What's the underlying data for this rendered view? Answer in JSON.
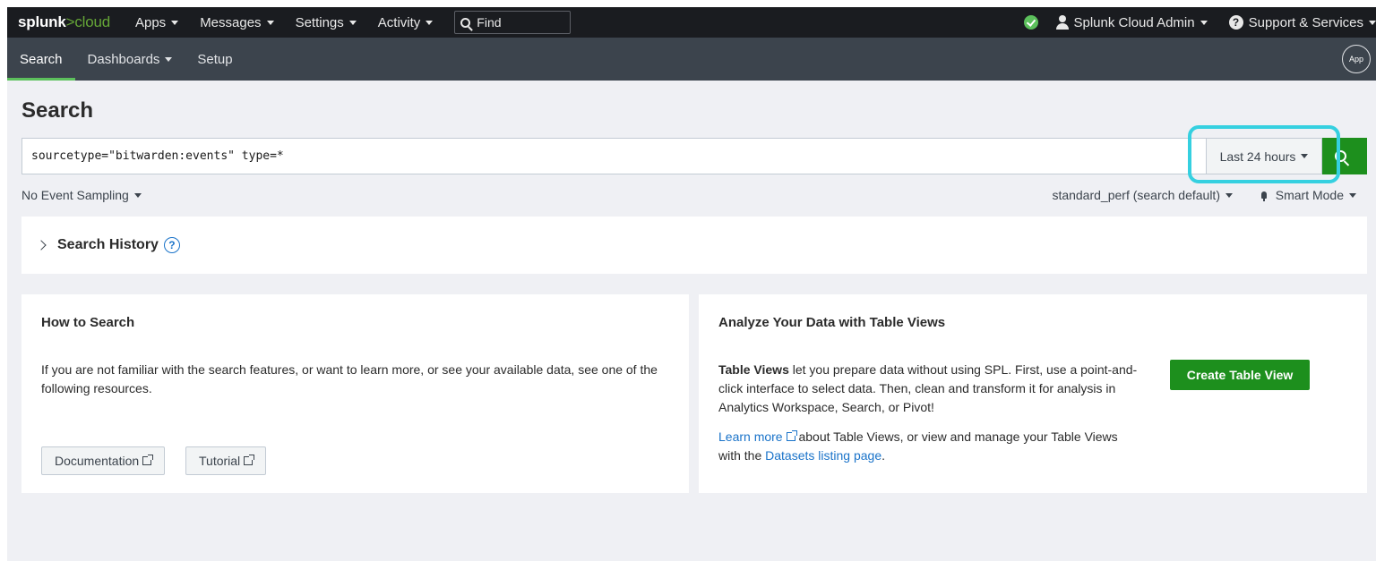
{
  "topbar": {
    "logo_main": "splunk",
    "logo_gt": ">",
    "logo_sub": "cloud",
    "menus": [
      "Apps",
      "Messages",
      "Settings",
      "Activity"
    ],
    "find_placeholder": "Find",
    "user": "Splunk Cloud Admin",
    "support": "Support & Services",
    "help_glyph": "?",
    "status_color": "#5cc05c"
  },
  "appbar": {
    "items": [
      {
        "label": "Search",
        "active": true
      },
      {
        "label": "Dashboards",
        "caret": true
      },
      {
        "label": "Setup"
      }
    ],
    "app_icon_label": "App"
  },
  "page": {
    "title": "Search",
    "query": "sourcetype=\"bitwarden:events\" type=*",
    "time_range": "Last 24 hours",
    "sampling": "No Event Sampling",
    "perf": "standard_perf (search default)",
    "mode": "Smart Mode",
    "history_label": "Search History",
    "history_help": "?"
  },
  "how_to": {
    "title": "How to Search",
    "body": "If you are not familiar with the search features, or want to learn more, or see your available data, see one of the following resources.",
    "doc_button": "Documentation",
    "tutorial_button": "Tutorial"
  },
  "table_views": {
    "title": "Analyze Your Data with Table Views",
    "body_bold": "Table Views",
    "body_rest": " let you prepare data without using SPL. First, use a point-and-click interface to select data. Then, clean and transform it for analysis in Analytics Workspace, Search, or Pivot!",
    "learn_more": "Learn more",
    "body2_mid": " about Table Views, or view and manage your Table Views with the ",
    "datasets_link": "Datasets listing page",
    "body2_end": ".",
    "create_button": "Create Table View"
  },
  "colors": {
    "accent_green": "#1d8f1d",
    "highlight": "#35d0e0",
    "link": "#1a73c9"
  }
}
